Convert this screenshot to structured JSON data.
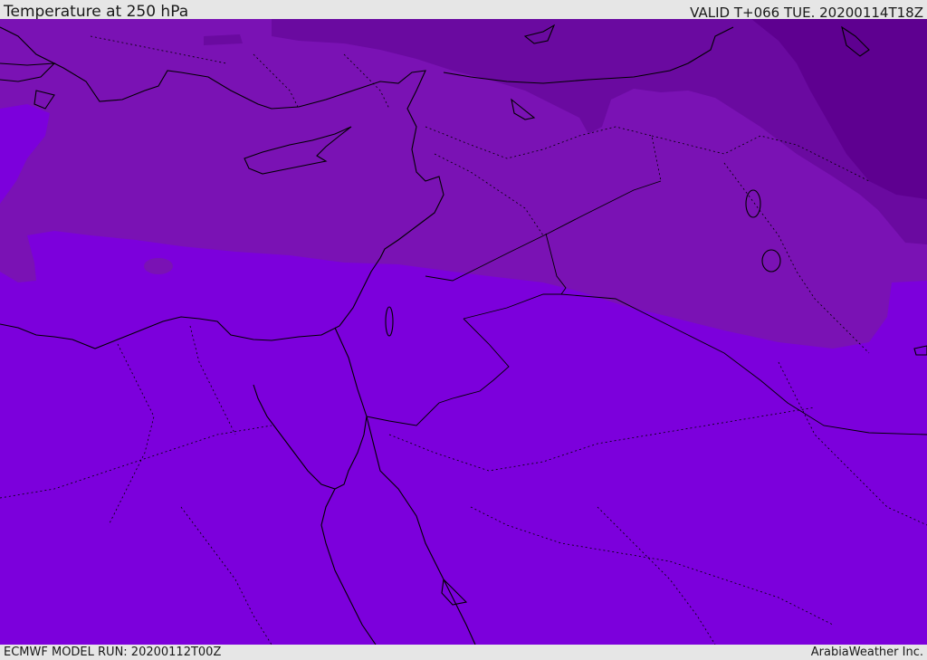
{
  "header": {
    "title": "Temperature at 250 hPa",
    "valid": "VALID T+066 TUE. 20200114T18Z"
  },
  "footer": {
    "model_run": "ECMWF MODEL RUN: 20200112T00Z",
    "credit": "ArabiaWeather Inc."
  },
  "colors": {
    "band_warmest": "#7c00dc",
    "band_mid": "#7a12b4",
    "band_cold": "#6a0aa0",
    "band_coldest": "#5e0090",
    "coastline": "#000000",
    "background": "#e6e6e6"
  }
}
